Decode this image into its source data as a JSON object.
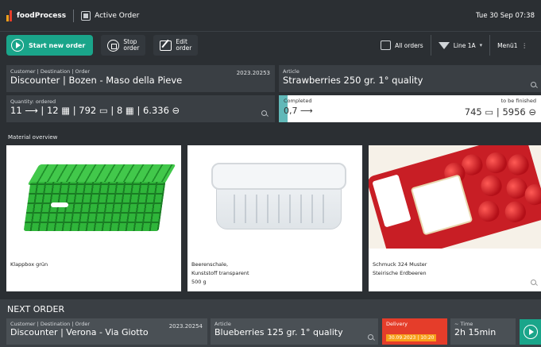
{
  "titlebar": {
    "brand": "foodProcess",
    "screen_title": "Active Order",
    "datetime": "Tue 30 Sep 07:38",
    "logo_colors": [
      "#f7a01a",
      "#e53d2a",
      "#1aa58a"
    ]
  },
  "toolbar": {
    "start_label": "Start new order",
    "stop_label_1": "Stop",
    "stop_label_2": "order",
    "edit_label_1": "Edit",
    "edit_label_2": "order",
    "all_orders_label": "All orders",
    "line_label": "Line 1A",
    "menu_label": "Menü1"
  },
  "current": {
    "customer_label": "Customer | Destination | Order",
    "customer_value": "Discounter | Bozen - Maso della Pieve",
    "order_number": "2023.20253",
    "article_label": "Article",
    "article_value": "Strawberries 250 gr. 1° quality",
    "quantity_label": "Quantity: ordered",
    "quantity_value": "11 ⟶ | 12 ▦ | 792 ▭ | 8 ▦ | 6.336 ⊖",
    "completed_label": "Completed",
    "completed_value": "0,7 ⟶",
    "completed_fraction": 0.032,
    "to_finish_label": "to be finished",
    "to_finish_value": "745 ▭ | 5956 ⊖"
  },
  "materials": {
    "title": "Material overview",
    "items": [
      {
        "caption_1": "Klappbox grün",
        "caption_2": "",
        "caption_3": ""
      },
      {
        "caption_1": "Beerenschale,",
        "caption_2": "Kunststoff transparent",
        "caption_3": "500 g"
      },
      {
        "caption_1": "Schmuck 324 Muster",
        "caption_2": "Steirische Erdbeeren",
        "caption_3": ""
      }
    ]
  },
  "next_order": {
    "title": "NEXT ORDER",
    "customer_label": "Customer | Destination | Order",
    "customer_value": "Discounter | Verona - Via Giotto",
    "order_number": "2023.20254",
    "article_label": "Article",
    "article_value": "Blueberries 125 gr. 1° quality",
    "delivery_label": "Delivery",
    "delivery_value": "30.09.2023 | 10:20",
    "time_label": "~ Time",
    "time_value": "2h 15min"
  },
  "colors": {
    "accent": "#1aa58a",
    "delivery": "#e53d2a",
    "progress": "#61b8b8"
  }
}
